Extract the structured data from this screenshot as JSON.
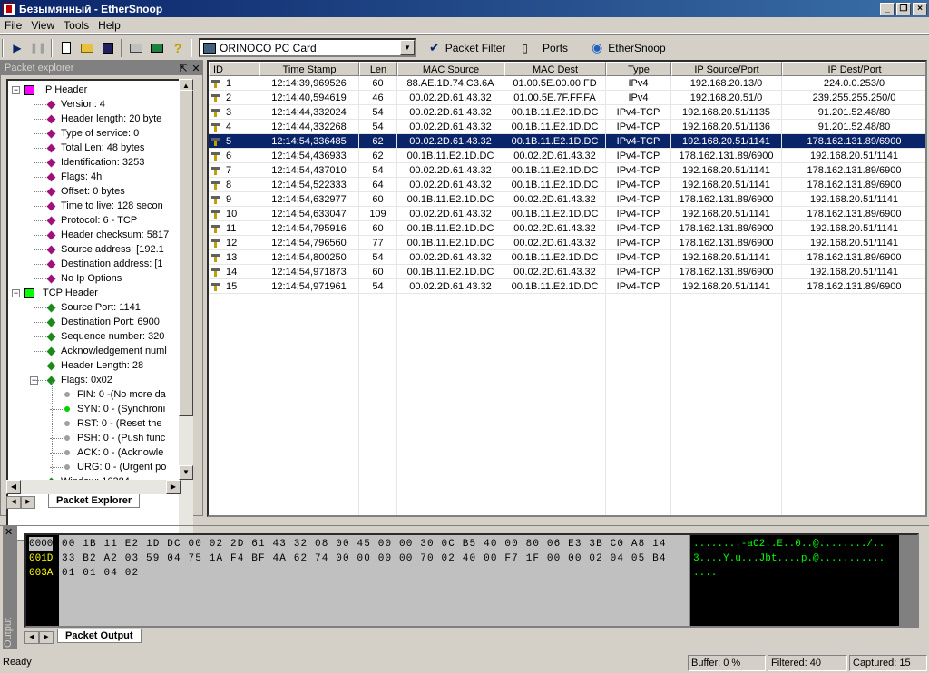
{
  "window": {
    "title": "Безымянный - EtherSnoop"
  },
  "menu": [
    "File",
    "View",
    "Tools",
    "Help"
  ],
  "toolbar": {
    "adapter": "ORINOCO PC Card",
    "packet_filter": "Packet Filter",
    "ports": "Ports",
    "ethersnoop": "EtherSnoop"
  },
  "packet_explorer": {
    "title": "Packet explorer",
    "tab": "Packet Explorer",
    "ip_header": "IP Header",
    "ip_fields": [
      "Version: 4",
      "Header length: 20 byte",
      "Type of service: 0",
      "Total Len: 48 bytes",
      "Identification: 3253",
      "Flags: 4h",
      "Offset: 0 bytes",
      "Time to live: 128 secon",
      "Protocol: 6 - TCP",
      "Header checksum: 5817",
      "Source address: [192.1",
      "Destination address: [1",
      "No Ip Options"
    ],
    "tcp_header": "TCP Header",
    "tcp_fields": [
      "Source Port: 1141",
      "Destination Port: 6900",
      "Sequence number: 320",
      "Acknowledgement numl",
      "Header Length: 28"
    ],
    "flags": "Flags: 0x02",
    "flag_items": [
      "FIN: 0 -(No more da",
      "SYN: 0 - (Synchroni",
      "RST: 0 - (Reset the",
      "PSH: 0 - (Push func",
      "ACK: 0 - (Acknowle",
      "URG: 0 - (Urgent po"
    ],
    "partial": "Window: 16384"
  },
  "grid": {
    "columns": [
      "ID",
      "Time Stamp",
      "Len",
      "MAC Source",
      "MAC Dest",
      "Type",
      "IP Source/Port",
      "IP Dest/Port"
    ],
    "selected_row": 5,
    "rows": [
      [
        "1",
        "12:14:39,969526",
        "60",
        "88.AE.1D.74.C3.6A",
        "01.00.5E.00.00.FD",
        "IPv4",
        "192.168.20.13/0",
        "224.0.0.253/0"
      ],
      [
        "2",
        "12:14:40,594619",
        "46",
        "00.02.2D.61.43.32",
        "01.00.5E.7F.FF.FA",
        "IPv4",
        "192.168.20.51/0",
        "239.255.255.250/0"
      ],
      [
        "3",
        "12:14:44,332024",
        "54",
        "00.02.2D.61.43.32",
        "00.1B.11.E2.1D.DC",
        "IPv4-TCP",
        "192.168.20.51/1135",
        "91.201.52.48/80"
      ],
      [
        "4",
        "12:14:44,332268",
        "54",
        "00.02.2D.61.43.32",
        "00.1B.11.E2.1D.DC",
        "IPv4-TCP",
        "192.168.20.51/1136",
        "91.201.52.48/80"
      ],
      [
        "5",
        "12:14:54,336485",
        "62",
        "00.02.2D.61.43.32",
        "00.1B.11.E2.1D.DC",
        "IPv4-TCP",
        "192.168.20.51/1141",
        "178.162.131.89/6900"
      ],
      [
        "6",
        "12:14:54,436933",
        "62",
        "00.1B.11.E2.1D.DC",
        "00.02.2D.61.43.32",
        "IPv4-TCP",
        "178.162.131.89/6900",
        "192.168.20.51/1141"
      ],
      [
        "7",
        "12:14:54,437010",
        "54",
        "00.02.2D.61.43.32",
        "00.1B.11.E2.1D.DC",
        "IPv4-TCP",
        "192.168.20.51/1141",
        "178.162.131.89/6900"
      ],
      [
        "8",
        "12:14:54,522333",
        "64",
        "00.02.2D.61.43.32",
        "00.1B.11.E2.1D.DC",
        "IPv4-TCP",
        "192.168.20.51/1141",
        "178.162.131.89/6900"
      ],
      [
        "9",
        "12:14:54,632977",
        "60",
        "00.1B.11.E2.1D.DC",
        "00.02.2D.61.43.32",
        "IPv4-TCP",
        "178.162.131.89/6900",
        "192.168.20.51/1141"
      ],
      [
        "10",
        "12:14:54,633047",
        "109",
        "00.02.2D.61.43.32",
        "00.1B.11.E2.1D.DC",
        "IPv4-TCP",
        "192.168.20.51/1141",
        "178.162.131.89/6900"
      ],
      [
        "11",
        "12:14:54,795916",
        "60",
        "00.1B.11.E2.1D.DC",
        "00.02.2D.61.43.32",
        "IPv4-TCP",
        "178.162.131.89/6900",
        "192.168.20.51/1141"
      ],
      [
        "12",
        "12:14:54,796560",
        "77",
        "00.1B.11.E2.1D.DC",
        "00.02.2D.61.43.32",
        "IPv4-TCP",
        "178.162.131.89/6900",
        "192.168.20.51/1141"
      ],
      [
        "13",
        "12:14:54,800250",
        "54",
        "00.02.2D.61.43.32",
        "00.1B.11.E2.1D.DC",
        "IPv4-TCP",
        "192.168.20.51/1141",
        "178.162.131.89/6900"
      ],
      [
        "14",
        "12:14:54,971873",
        "60",
        "00.1B.11.E2.1D.DC",
        "00.02.2D.61.43.32",
        "IPv4-TCP",
        "178.162.131.89/6900",
        "192.168.20.51/1141"
      ],
      [
        "15",
        "12:14:54,971961",
        "54",
        "00.02.2D.61.43.32",
        "00.1B.11.E2.1D.DC",
        "IPv4-TCP",
        "192.168.20.51/1141",
        "178.162.131.89/6900"
      ]
    ]
  },
  "output": {
    "label": "Output",
    "tab": "Packet Output",
    "offsets": [
      "0000",
      "001D",
      "003A"
    ],
    "hex": [
      "00 1B 11 E2 1D DC 00 02 2D 61 43 32 08 00 45 00 00 30 0C B5 40 00 80 06 E3 3B C0 A8 14",
      "33 B2 A2 03 59 04 75 1A F4 BF 4A 62 74 00 00 00 00 70 02 40 00 F7 1F 00 00 02 04 05 B4",
      "01 01 04 02"
    ],
    "ascii": [
      "........-aC2..E..0..@......../..",
      "3....Y.u...Jbt....p.@...........",
      "...."
    ]
  },
  "status": {
    "ready": "Ready",
    "buffer": "Buffer: 0 %",
    "filtered": "Filtered: 40",
    "captured": "Captured: 15"
  }
}
